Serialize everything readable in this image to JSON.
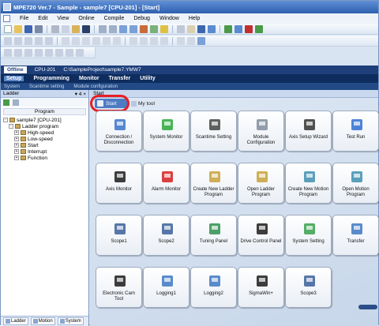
{
  "window": {
    "title": "MPE720 Ver.7 - Sample - sample7 [CPU-201] - [Start]"
  },
  "menu": [
    "File",
    "Edit",
    "View",
    "Online",
    "Compile",
    "Debug",
    "Window",
    "Help"
  ],
  "path_bar": {
    "status": "Offline",
    "cpu": "CPU-201",
    "path": "C:\\SampleProject\\sample7.YMW7"
  },
  "ribbon": {
    "tabs": [
      "Setup",
      "Programming",
      "Monitor",
      "Transfer",
      "Utility"
    ],
    "subtabs": [
      "System",
      "Scantime setting",
      "Module configuration"
    ]
  },
  "left_panel": {
    "title": "Ladder",
    "pin": "▾ 4 ×",
    "program_label": "Program",
    "tree": [
      {
        "pm": "-",
        "label": "sample7 [CPU-201]",
        "indent": 0
      },
      {
        "pm": "-",
        "label": "Ladder program",
        "indent": 1
      },
      {
        "pm": "+",
        "label": "High-speed",
        "indent": 2
      },
      {
        "pm": "+",
        "label": "Low-speed",
        "indent": 2
      },
      {
        "pm": "+",
        "label": "Start",
        "indent": 2
      },
      {
        "pm": "+",
        "label": "Interrupt",
        "indent": 2
      },
      {
        "pm": "+",
        "label": "Function",
        "indent": 2
      }
    ],
    "bottom_tabs": [
      "Ladder",
      "Motion",
      "System"
    ]
  },
  "main": {
    "header": "Start",
    "start_tab": "Start",
    "my_tool_tab": "My tool",
    "tiles": [
      {
        "label": "Connection / Disconnection",
        "icon": "connection-icon",
        "color": "#3a73c8"
      },
      {
        "label": "System Monitor",
        "icon": "system-monitor-icon",
        "color": "#2aa83a"
      },
      {
        "label": "Scantime Setting",
        "icon": "scantime-icon",
        "color": "#444444"
      },
      {
        "label": "Module Configuration",
        "icon": "module-config-icon",
        "color": "#7f8c9d"
      },
      {
        "label": "Axis Setup Wizard",
        "icon": "axis-wizard-icon",
        "color": "#333333"
      },
      {
        "label": "Test Run",
        "icon": "test-run-icon",
        "color": "#2f6fd0"
      },
      {
        "label": "Axis Monitor",
        "icon": "axis-monitor-icon",
        "color": "#1b1b1b"
      },
      {
        "label": "Alarm Monitor",
        "icon": "alarm-monitor-icon",
        "color": "#d61f1f"
      },
      {
        "label": "Create New Ladder Program",
        "icon": "new-ladder-icon",
        "color": "#c8a13a"
      },
      {
        "label": "Open Ladder Program",
        "icon": "open-ladder-icon",
        "color": "#c8a13a"
      },
      {
        "label": "Create New Motion Program",
        "icon": "new-motion-icon",
        "color": "#3f8fb0"
      },
      {
        "label": "Open Motion Program",
        "icon": "open-motion-icon",
        "color": "#3f8fb0"
      },
      {
        "label": "Scope1",
        "icon": "scope1-icon",
        "color": "#3a5f9a"
      },
      {
        "label": "Scope2",
        "icon": "scope2-icon",
        "color": "#3a5f9a"
      },
      {
        "label": "Tuning Panel",
        "icon": "tuning-panel-icon",
        "color": "#2f8f4f"
      },
      {
        "label": "Drive Control Panel",
        "icon": "drive-control-icon",
        "color": "#1b1b1b"
      },
      {
        "label": "System Setting",
        "icon": "system-setting-icon",
        "color": "#36a04a"
      },
      {
        "label": "Transfer",
        "icon": "transfer-icon",
        "color": "#3d78c2"
      },
      {
        "label": "Electronic Cam Tool",
        "icon": "cam-tool-icon",
        "color": "#1b1b1b"
      },
      {
        "label": "Logging1",
        "icon": "logging1-icon",
        "color": "#3d78c2"
      },
      {
        "label": "Logging2",
        "icon": "logging2-icon",
        "color": "#3d78c2"
      },
      {
        "label": "SigmaWin+",
        "icon": "sigmawin-icon",
        "color": "#1b1b1b"
      },
      {
        "label": "Scope3",
        "icon": "scope3-icon",
        "color": "#3a5f9a"
      }
    ]
  },
  "colors": {
    "highlight": "#e81e25",
    "ribbon": "#0e2d5e",
    "accent": "#4d7cc4"
  }
}
